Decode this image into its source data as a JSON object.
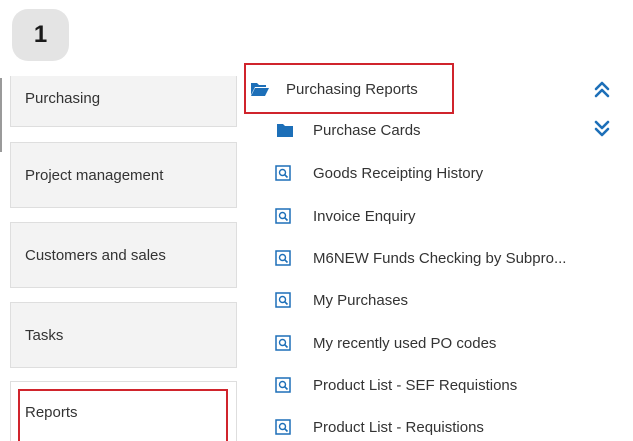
{
  "step_number": "1",
  "nav": {
    "items": [
      {
        "label": "Purchasing"
      },
      {
        "label": "Project management"
      },
      {
        "label": "Customers and sales"
      },
      {
        "label": "Tasks"
      },
      {
        "label": "Reports"
      }
    ],
    "selected": "Reports"
  },
  "tree": {
    "folder_label": "Purchasing Reports",
    "children": [
      {
        "label": "Purchase Cards",
        "icon": "folder-icon"
      },
      {
        "label": "Goods Receipting History",
        "icon": "report-icon"
      },
      {
        "label": "Invoice Enquiry",
        "icon": "report-icon"
      },
      {
        "label": "M6NEW Funds Checking by Subpro...",
        "icon": "report-icon"
      },
      {
        "label": "My Purchases",
        "icon": "report-icon"
      },
      {
        "label": "My recently used PO codes",
        "icon": "report-icon"
      },
      {
        "label": "Product List - SEF Requistions",
        "icon": "report-icon"
      },
      {
        "label": "Product List - Requistions",
        "icon": "report-icon"
      }
    ]
  },
  "colors": {
    "highlight": "#d0242c",
    "icon_blue": "#1d6fb8",
    "nav_bg": "#f3f3f3",
    "badge_bg": "#e4e4e4"
  }
}
